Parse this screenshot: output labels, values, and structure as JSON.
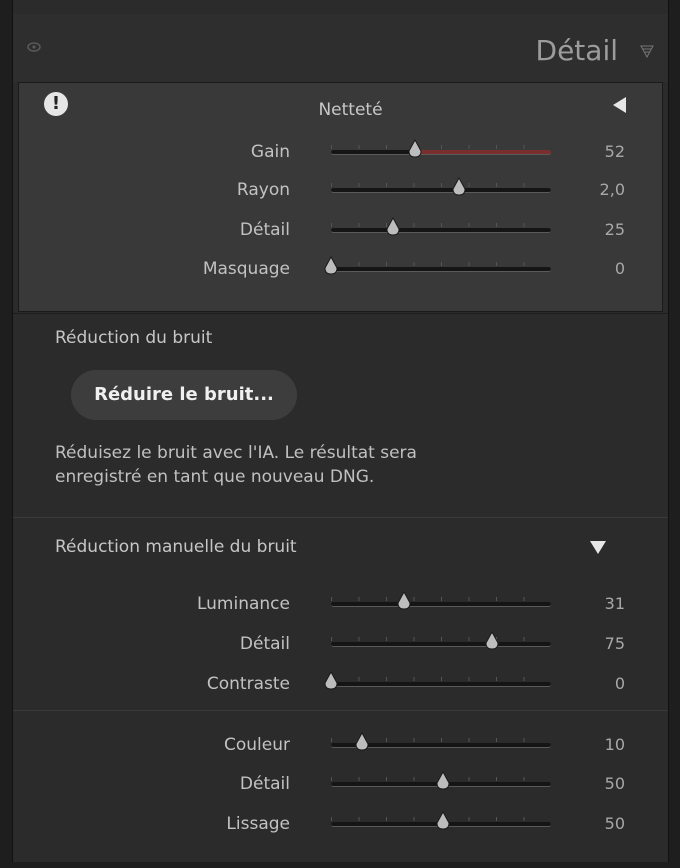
{
  "header": {
    "title": "Détail"
  },
  "sharpening": {
    "title": "Netteté",
    "rows": [
      {
        "label": "Gain",
        "value": "52",
        "pos": 0.38,
        "tinted": true
      },
      {
        "label": "Rayon",
        "value": "2,0",
        "pos": 0.58
      },
      {
        "label": "Détail",
        "value": "25",
        "pos": 0.28
      },
      {
        "label": "Masquage",
        "value": "0",
        "pos": 0.0
      }
    ]
  },
  "noise": {
    "title": "Réduction du bruit",
    "button": "Réduire le bruit...",
    "description_line1": "Réduisez le bruit avec l'IA. Le résultat sera",
    "description_line2": "enregistré en tant que nouveau DNG."
  },
  "manual": {
    "title": "Réduction manuelle du bruit",
    "luma_rows": [
      {
        "label": "Luminance",
        "value": "31",
        "pos": 0.33
      },
      {
        "label": "Détail",
        "value": "75",
        "pos": 0.73
      },
      {
        "label": "Contraste",
        "value": "0",
        "pos": 0.0
      }
    ],
    "color_rows": [
      {
        "label": "Couleur",
        "value": "10",
        "pos": 0.14
      },
      {
        "label": "Détail",
        "value": "50",
        "pos": 0.51
      },
      {
        "label": "Lissage",
        "value": "50",
        "pos": 0.51
      }
    ]
  },
  "colors": {
    "gain_track": "#7a2f2f",
    "accent": "#e6e6e6"
  }
}
